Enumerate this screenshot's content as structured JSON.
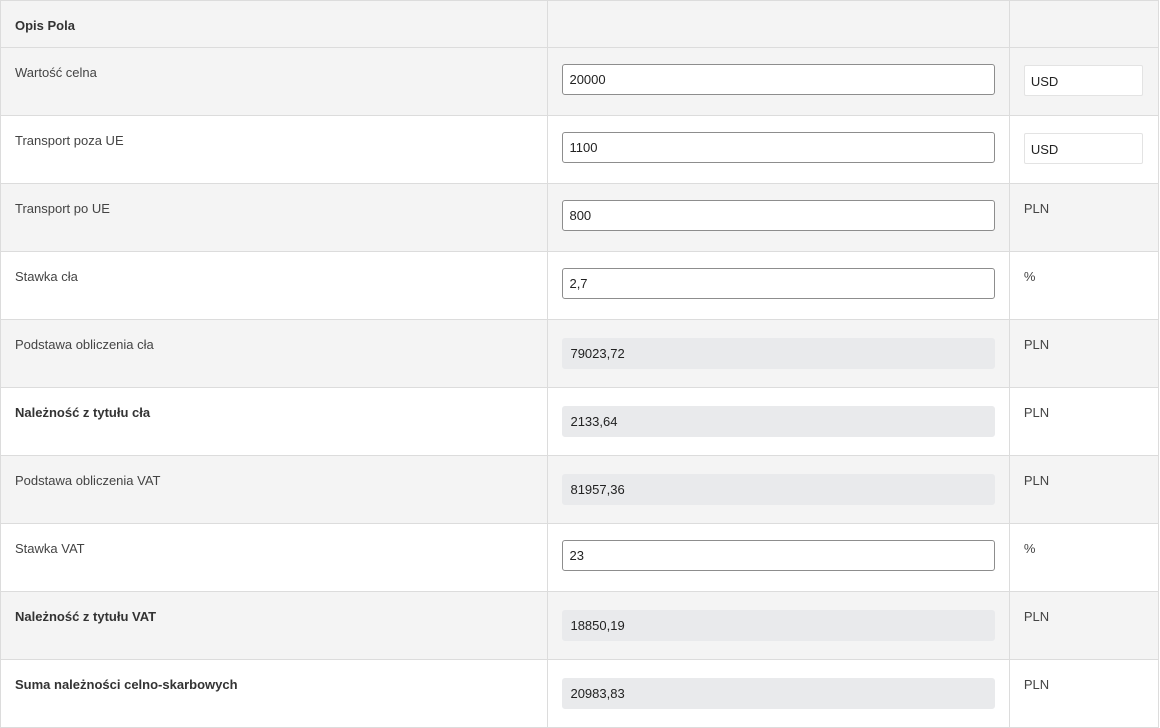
{
  "header": {
    "description_label": "Opis Pola",
    "value_label": "",
    "unit_label": ""
  },
  "rows": [
    {
      "label": "Wartość celna",
      "value": "20000",
      "unit": "USD"
    },
    {
      "label": "Transport poza UE",
      "value": "1100",
      "unit": "USD"
    },
    {
      "label": "Transport po UE",
      "value": "800",
      "unit": "PLN"
    },
    {
      "label": "Stawka cła",
      "value": "2,7",
      "unit": "%"
    },
    {
      "label": "Podstawa obliczenia cła",
      "value": "79023,72",
      "unit": "PLN"
    },
    {
      "label": "Należność z tytułu cła",
      "value": "2133,64",
      "unit": "PLN"
    },
    {
      "label": "Podstawa obliczenia VAT",
      "value": "81957,36",
      "unit": "PLN"
    },
    {
      "label": "Stawka VAT",
      "value": "23",
      "unit": "%"
    },
    {
      "label": "Należność z tytułu VAT",
      "value": "18850,19",
      "unit": "PLN"
    },
    {
      "label": "Suma należności celno-skarbowych",
      "value": "20983,83",
      "unit": "PLN"
    }
  ]
}
